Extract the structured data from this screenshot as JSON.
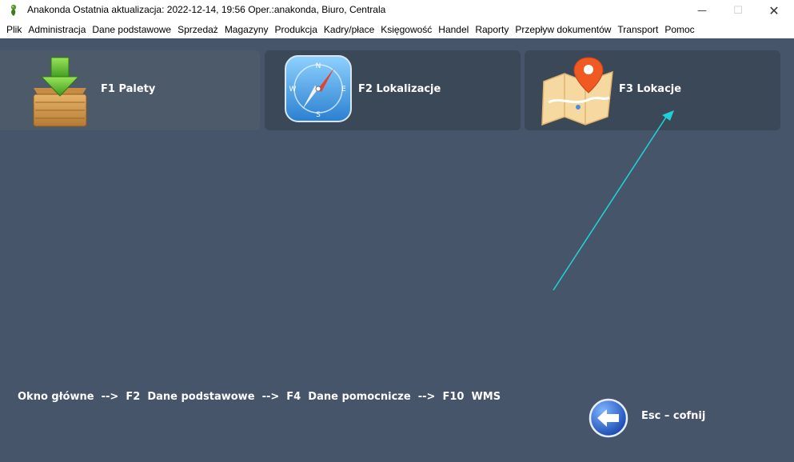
{
  "window": {
    "title": "Anakonda Ostatnia aktualizacja: 2022-12-14, 19:56 Oper.:anakonda, Biuro, Centrala",
    "minimize_glyph": "—",
    "maximize_glyph": "☐",
    "close_glyph": "✕"
  },
  "menu": {
    "items": [
      {
        "label": "Plik"
      },
      {
        "label": "Administracja"
      },
      {
        "label": "Dane podstawowe"
      },
      {
        "label": "Sprzedaż"
      },
      {
        "label": "Magazyny"
      },
      {
        "label": "Produkcja"
      },
      {
        "label": "Kadry/płace"
      },
      {
        "label": "Księgowość"
      },
      {
        "label": "Handel"
      },
      {
        "label": "Raporty"
      },
      {
        "label": "Przepływ dokumentów"
      },
      {
        "label": "Transport"
      },
      {
        "label": "Pomoc"
      }
    ]
  },
  "tiles": [
    {
      "label": "F1  Palety",
      "icon": "pallet-box-download-icon"
    },
    {
      "label": "F2  Lokalizacje",
      "icon": "compass-icon"
    },
    {
      "label": "F3  Lokacje",
      "icon": "map-pin-icon"
    }
  ],
  "breadcrumb": "Okno główne  -->  F2  Dane podstawowe  -->  F4  Dane pomocnicze  -->  F10  WMS",
  "back": {
    "label": "Esc – cofnij",
    "icon": "back-arrow-icon"
  },
  "colors": {
    "workspace": "#465569",
    "tile": "#3b4858",
    "tile_active": "#4d5a6a",
    "annotation_arrow": "#1fd1d6"
  }
}
